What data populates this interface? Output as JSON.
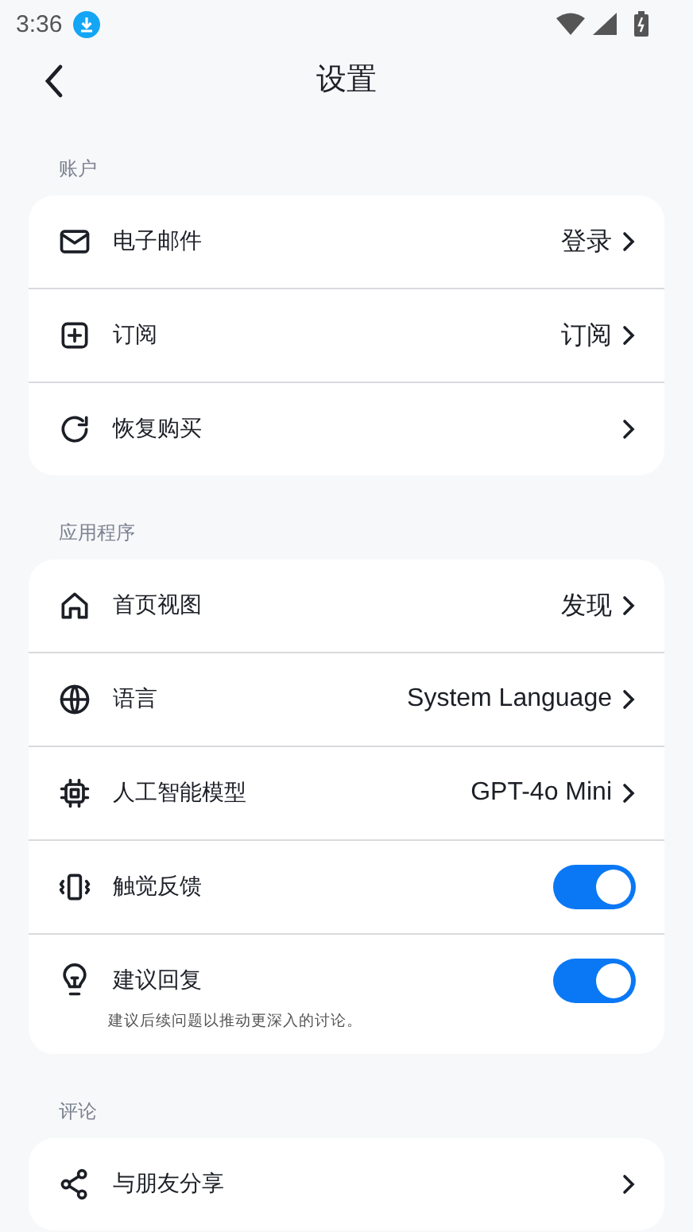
{
  "status_bar": {
    "time": "3:36"
  },
  "header": {
    "title": "设置"
  },
  "sections": [
    {
      "label": "账户",
      "rows": [
        {
          "kind": "link",
          "label": "电子邮件",
          "value": "登录"
        },
        {
          "kind": "link",
          "label": "订阅",
          "value": "订阅"
        },
        {
          "kind": "link",
          "label": "恢复购买"
        }
      ]
    },
    {
      "label": "应用程序",
      "rows": [
        {
          "kind": "link",
          "label": "首页视图",
          "value": "发现"
        },
        {
          "kind": "link",
          "label": "语言",
          "value": "System Language"
        },
        {
          "kind": "link",
          "label": "人工智能模型",
          "value": "GPT-4o Mini"
        },
        {
          "kind": "toggle",
          "label": "触觉反馈",
          "on": true
        },
        {
          "kind": "toggle",
          "label": "建议回复",
          "on": true,
          "note": "建议后续问题以推动更深入的讨论。"
        }
      ]
    },
    {
      "label": "评论",
      "rows": [
        {
          "kind": "link",
          "label": "与朋友分享"
        }
      ]
    }
  ]
}
